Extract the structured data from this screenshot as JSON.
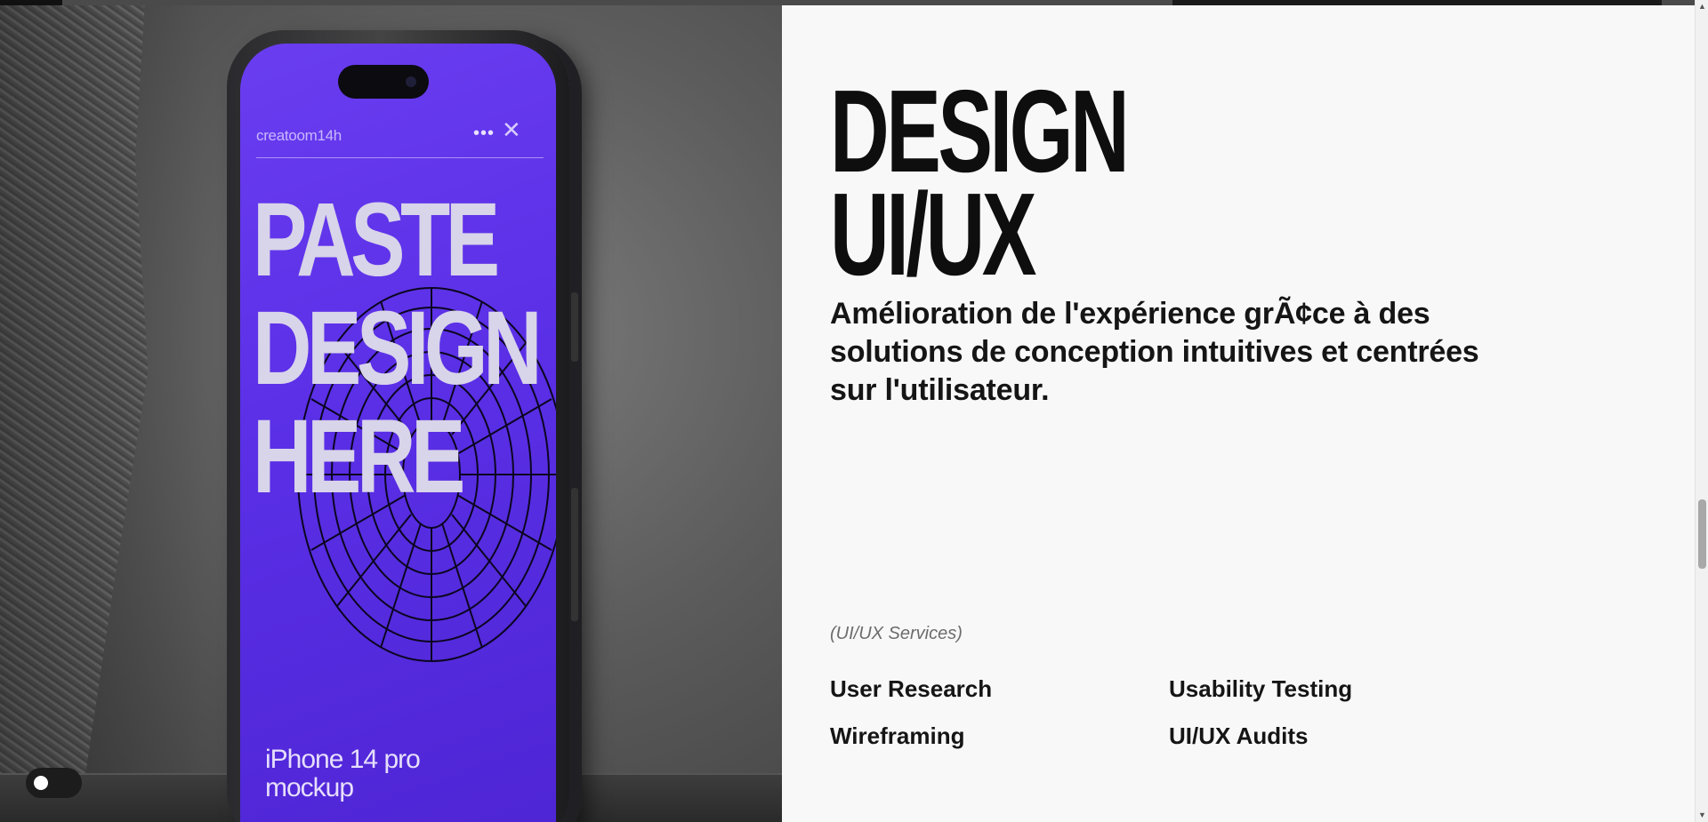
{
  "hero_image": {
    "brand": "creatoom14h",
    "menu_glyph": "•••",
    "close_glyph": "✕",
    "headline": [
      "PASTE",
      "DESIGN",
      "HERE"
    ],
    "caption": [
      "iPhone 14 pro",
      "mockup"
    ]
  },
  "section": {
    "title_lines": [
      "DESIGN",
      "UI/UX"
    ],
    "description": "Amélioration de l'expérience grÃ¢ce à des solutions de conception intuitives et centrées sur l'utilisateur.",
    "services_label": "(UI/UX Services)",
    "services": [
      "User Research",
      "Usability Testing",
      "Wireframing",
      "UI/UX Audits"
    ]
  },
  "theme_toggle": {
    "state": "off"
  },
  "scrollbar": {
    "up_glyph": "▲",
    "down_glyph": "▼"
  },
  "colors": {
    "phone_screen": "#5a2fe6",
    "text_primary": "#151515",
    "background": "#f8f8f8"
  }
}
